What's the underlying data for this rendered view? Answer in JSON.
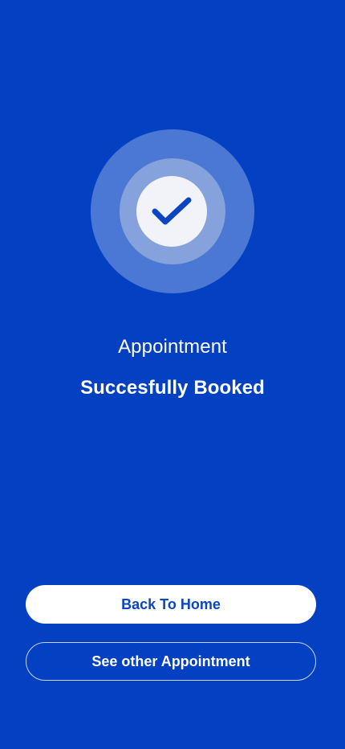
{
  "screen": {
    "title": "Appointment",
    "subtitle": "Succesfully Booked"
  },
  "actions": {
    "primary_label": "Back To Home",
    "secondary_label": "See other Appointment"
  },
  "icons": {
    "success": "check-icon"
  },
  "colors": {
    "background": "#0341c2",
    "accent": "#0b45c1",
    "outer_ring": "#4b78d5",
    "middle_ring": "#86a2dc",
    "inner_circle": "#f1f3f8"
  }
}
